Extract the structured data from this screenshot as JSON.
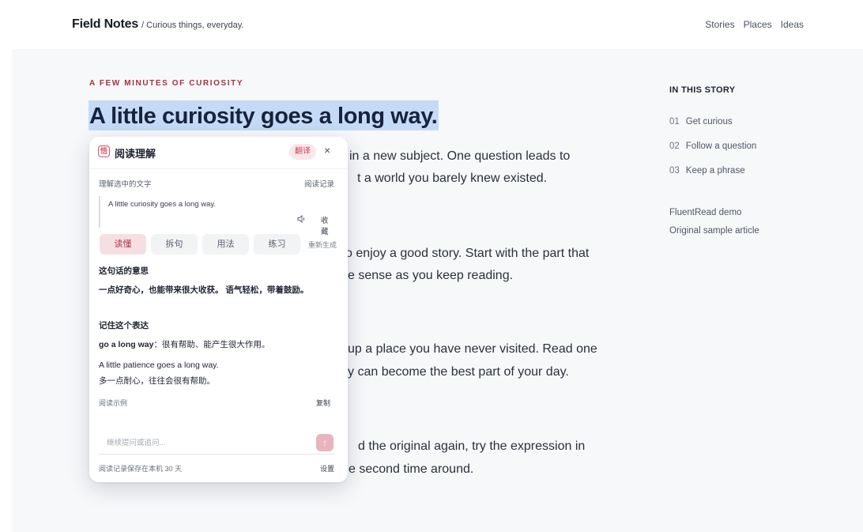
{
  "header": {
    "brand": "Field Notes",
    "tagline": "/ Curious things, everyday.",
    "nav": [
      "Stories",
      "Places",
      "Ideas"
    ]
  },
  "article": {
    "eyebrow": "A FEW MINUTES OF CURIOSITY",
    "headline": "A little curiosity goes a long way.",
    "visible_lines": [
      "in a new subject. One question leads to",
      "t a world you barely knew existed.",
      "o enjoy a good story. Start with the part that",
      "e sense as you keep reading.",
      "up a place you have never visited. Read one",
      "y can become the best part of your day.",
      "d the original again, try the expression in",
      "e second time around."
    ]
  },
  "toc": {
    "title": "IN THIS STORY",
    "items": [
      {
        "num": "01",
        "label": "Get curious"
      },
      {
        "num": "02",
        "label": "Follow a question"
      },
      {
        "num": "03",
        "label": "Keep a phrase"
      }
    ],
    "links": [
      "FluentRead demo",
      "Original sample article"
    ]
  },
  "panel": {
    "logo_glyph": "悟",
    "title": "阅读理解",
    "translate_label": "翻译",
    "close_label": "×",
    "selection_label": "理解选中的文字",
    "history_label": "阅读记录",
    "selected_text": "A little curiosity goes a long way.",
    "speak_icon": "speaker-icon",
    "favorite_label": "收藏",
    "tabs": [
      {
        "label": "读懂",
        "active": true
      },
      {
        "label": "拆句",
        "active": false
      },
      {
        "label": "用法",
        "active": false
      },
      {
        "label": "练习",
        "active": false
      }
    ],
    "regenerate_label": "重新生成",
    "meaning_title": "这句话的意思",
    "meaning_text": "一点好奇心，也能带来很大收获。 语气轻松，带着鼓励。",
    "phrase_title": "记住这个表达",
    "phrase_term": "go a long way",
    "phrase_gloss": "：很有帮助、能产生很大作用。",
    "example_en": "A little patience goes a long way.",
    "example_zh": "多一点耐心，往往会很有帮助。",
    "example_label": "阅读示例",
    "copy_label": "复制",
    "input_placeholder": "继续提问或追问...",
    "send_icon": "arrow-up-icon",
    "footer_note": "阅读记录保存在本机 30 天",
    "settings_label": "设置"
  }
}
